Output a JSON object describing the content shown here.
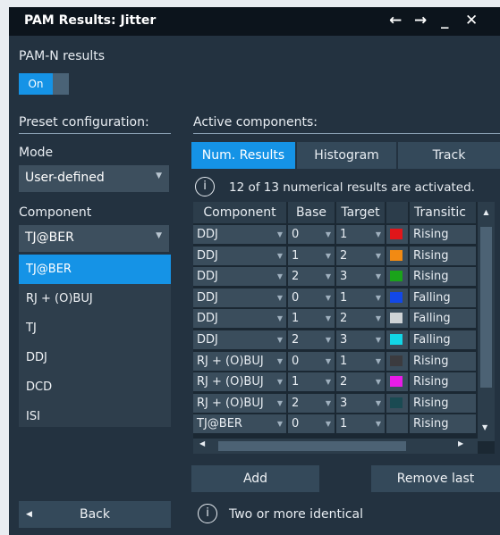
{
  "window": {
    "title": "PAM Results: Jitter",
    "icons": [
      "arrow-left-icon",
      "arrow-right-icon",
      "minimize-icon",
      "close-icon"
    ]
  },
  "pamn": {
    "label": "PAM-N results",
    "toggle": "On",
    "toggle_state": true
  },
  "left": {
    "preset_label": "Preset configuration:",
    "mode_label": "Mode",
    "mode_value": "User-defined",
    "component_label": "Component",
    "component_value": "TJ@BER",
    "options": [
      "TJ@BER",
      "RJ + (O)BUJ",
      "TJ",
      "DDJ",
      "DCD",
      "ISI"
    ],
    "selected_option": "TJ@BER",
    "back_label": "Back"
  },
  "right": {
    "active_label": "Active components:",
    "tabs": [
      {
        "label": "Num. Results",
        "active": true
      },
      {
        "label": "Histogram",
        "active": false
      },
      {
        "label": "Track",
        "active": false
      }
    ],
    "info_text": "12 of 13 numerical results are activated.",
    "columns": [
      "Component",
      "Base",
      "Target",
      "",
      "Transitic"
    ],
    "rows": [
      {
        "component": "DDJ",
        "base": "0",
        "target": "1",
        "color": "#e0161a",
        "transition": "Rising"
      },
      {
        "component": "DDJ",
        "base": "1",
        "target": "2",
        "color": "#f28a13",
        "transition": "Rising"
      },
      {
        "component": "DDJ",
        "base": "2",
        "target": "3",
        "color": "#1aa31a",
        "transition": "Rising"
      },
      {
        "component": "DDJ",
        "base": "0",
        "target": "1",
        "color": "#1248e8",
        "transition": "Falling"
      },
      {
        "component": "DDJ",
        "base": "1",
        "target": "2",
        "color": "#cfd3d6",
        "transition": "Falling"
      },
      {
        "component": "DDJ",
        "base": "2",
        "target": "3",
        "color": "#12d6e6",
        "transition": "Falling"
      },
      {
        "component": "RJ + (O)BUJ",
        "base": "0",
        "target": "1",
        "color": "#3b3b3f",
        "transition": "Rising"
      },
      {
        "component": "RJ + (O)BUJ",
        "base": "1",
        "target": "2",
        "color": "#e81be8",
        "transition": "Rising"
      },
      {
        "component": "RJ + (O)BUJ",
        "base": "2",
        "target": "3",
        "color": "#1a4a52",
        "transition": "Rising"
      },
      {
        "component": "TJ@BER",
        "base": "0",
        "target": "1",
        "color": "",
        "transition": "Rising"
      }
    ],
    "add_label": "Add",
    "remove_label": "Remove last",
    "footer_info": "Two or more identical"
  }
}
